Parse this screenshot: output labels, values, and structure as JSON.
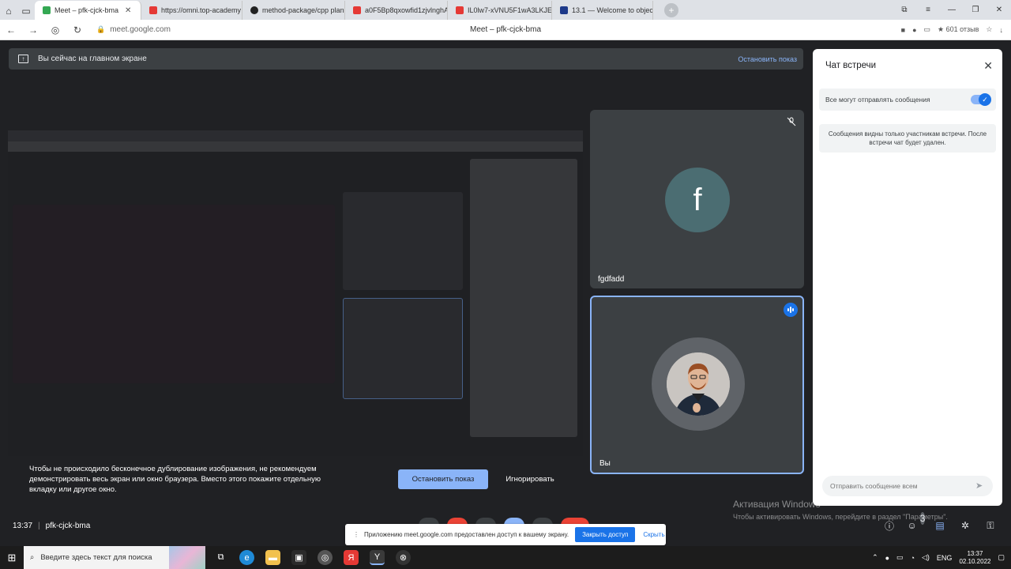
{
  "browser": {
    "tabs": [
      {
        "label": "Meet – pfk-cjck-bma",
        "active": true,
        "color": "#34a853"
      },
      {
        "label": "https://omni.top-academy",
        "active": false,
        "color": "#e53935"
      },
      {
        "label": "method-package/cpp plan",
        "active": false,
        "color": "#222222"
      },
      {
        "label": "a0F5Bp8qxowfid1zjvlnghA",
        "active": false,
        "color": "#e53935"
      },
      {
        "label": "IL0lw7-xVNU5F1wA3LKJEE",
        "active": false,
        "color": "#e53935"
      },
      {
        "label": "13.1 — Welcome to object",
        "active": false,
        "color": "#1e3a8a"
      }
    ],
    "url": "meet.google.com",
    "page_title": "Meet – pfk-cjck-bma",
    "stars": "★ 601 отзыв"
  },
  "meet": {
    "banner_text": "Вы сейчас на главном экране",
    "banner_stop": "Остановить показ",
    "participants": [
      {
        "name": "fgdfadd",
        "initial": "f",
        "muted": true
      },
      {
        "name": "Вы",
        "speaking": true
      }
    ],
    "warning_text": "Чтобы не происходило бесконечное дублирование изображения, не рекомендуем демонстрировать весь экран или окно браузера. Вместо этого покажите отдельную вкладку или другое окно.",
    "stop_button": "Остановить показ",
    "ignore_button": "Игнорировать",
    "time": "13:37",
    "meeting_code": "pfk-cjck-bma",
    "share_bar_text": "Приложению meet.google.com предоставлен доступ к вашему экрану.",
    "share_bar_close": "Закрыть доступ",
    "share_bar_hide": "Скрыть",
    "people_count": "3"
  },
  "chat": {
    "title": "Чат встречи",
    "toggle_label": "Все могут отправлять сообщения",
    "note": "Сообщения видны только участникам встречи. После встречи чат будет удален.",
    "input_placeholder": "Отправить сообщение всем"
  },
  "activation": {
    "title": "Активация Windows",
    "subtitle": "Чтобы активировать Windows, перейдите в раздел \"Параметры\"."
  },
  "taskbar": {
    "search_placeholder": "Введите здесь текст для поиска",
    "lang": "ENG",
    "time": "13:37",
    "date": "02.10.2022"
  }
}
